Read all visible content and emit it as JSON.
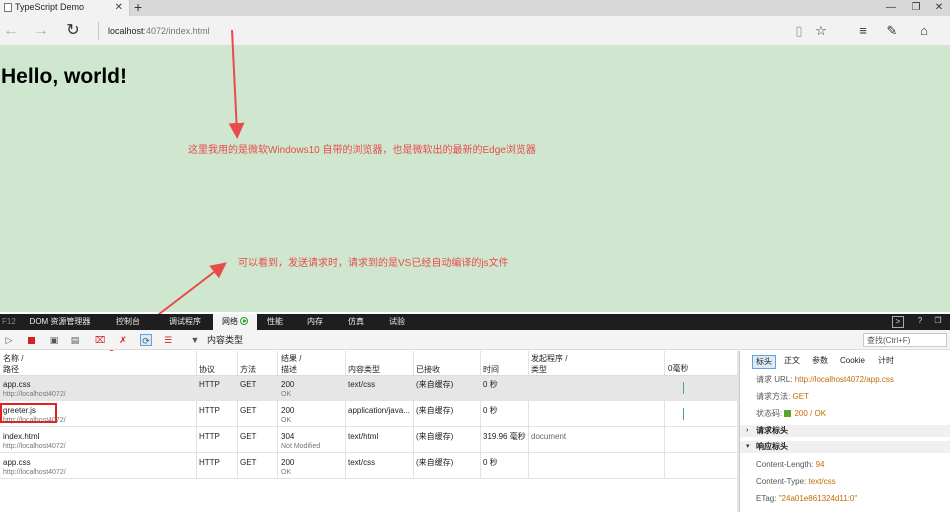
{
  "browser": {
    "tab_title": "TypeScript Demo",
    "close_glyph": "✕",
    "new_tab_glyph": "+",
    "url_host": "localhost",
    "url_rest": ":4072/index.html",
    "window_controls": [
      "—",
      "❐",
      "✕"
    ]
  },
  "page": {
    "heading": "Hello, world!",
    "background": "#cfe7cf"
  },
  "annotations": {
    "note_top": "这里我用的是微软Windows10 自带的浏览器，也是微软出的最新的Edge浏览器",
    "note_bottom": "可以看到，发送请求时，请求到的是VS已经自动编译的js文件",
    "color": "#e84b4b"
  },
  "devtools": {
    "f12_label": "F12",
    "tabs": [
      "DOM 资源管理器",
      "控制台",
      "调试程序",
      "网络",
      "性能",
      "内存",
      "仿真",
      "试验"
    ],
    "active_tab": "网络",
    "filter_label": "内容类型",
    "search_placeholder": "查找(Ctrl+F)"
  },
  "network": {
    "columns": [
      {
        "line1": "名称 /",
        "line2": "路径"
      },
      {
        "line1": "协议",
        "line2": ""
      },
      {
        "line1": "方法",
        "line2": ""
      },
      {
        "line1": "结果 /",
        "line2": "描述"
      },
      {
        "line1": "内容类型",
        "line2": ""
      },
      {
        "line1": "已接收",
        "line2": ""
      },
      {
        "line1": "时间",
        "line2": ""
      },
      {
        "line1": "发起程序 /",
        "line2": "类型"
      },
      {
        "line1": "0毫秒",
        "line2": ""
      }
    ],
    "rows": [
      {
        "name": "app.css",
        "path": "http://localhost4072/",
        "protocol": "HTTP",
        "method": "GET",
        "result": "200",
        "desc": "OK",
        "type": "text/css",
        "received": "(来自缓存)",
        "time": "0 秒",
        "initiator": ""
      },
      {
        "name": "greeter.js",
        "path": "http://localhost4072/",
        "protocol": "HTTP",
        "method": "GET",
        "result": "200",
        "desc": "OK",
        "type": "application/java...",
        "received": "(来自缓存)",
        "time": "0 秒",
        "initiator": ""
      },
      {
        "name": "index.html",
        "path": "http://localhost4072/",
        "protocol": "HTTP",
        "method": "GET",
        "result": "304",
        "desc": "Not Modified",
        "type": "text/html",
        "received": "(来自缓存)",
        "time": "319.96 毫秒",
        "initiator": "document"
      },
      {
        "name": "app.css",
        "path": "http://localhost4072/",
        "protocol": "HTTP",
        "method": "GET",
        "result": "200",
        "desc": "OK",
        "type": "text/css",
        "received": "(来自缓存)",
        "time": "0 秒",
        "initiator": ""
      }
    ]
  },
  "details": {
    "tabs": [
      "标头",
      "正文",
      "参数",
      "Cookie",
      "计时"
    ],
    "active_tab": "标头",
    "request_url_label": "请求 URL:",
    "request_url": "http://localhost4072/app.css",
    "request_method_label": "请求方法:",
    "request_method": "GET",
    "status_label": "状态码:",
    "status": "200 / OK",
    "request_headers": "请求标头",
    "response_headers": "响应标头",
    "content_length_label": "Content-Length:",
    "content_length": "94",
    "content_type_label": "Content-Type:",
    "content_type": "text/css",
    "etag_label": "ETag:",
    "etag": "\"24a01e861324d11:0\""
  }
}
